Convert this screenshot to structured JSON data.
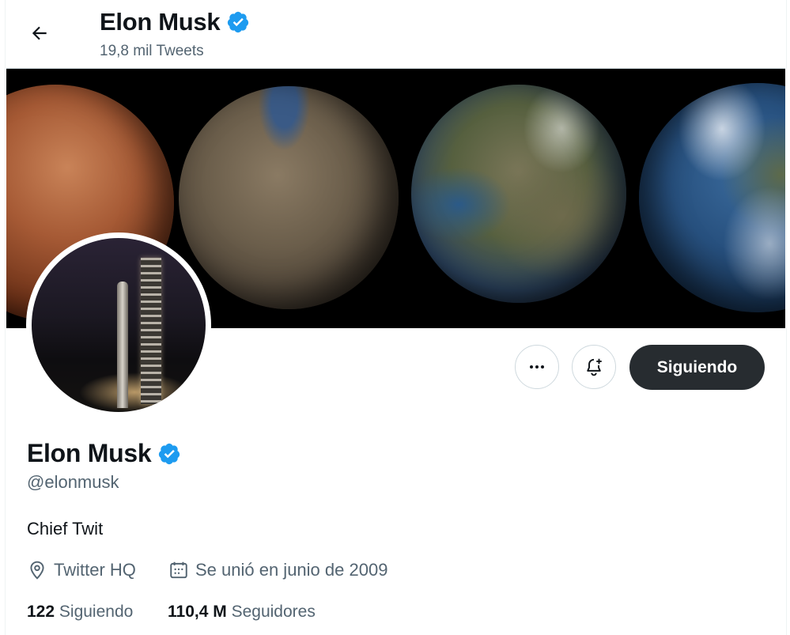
{
  "header": {
    "title": "Elon Musk",
    "tweet_count": "19,8 mil Tweets"
  },
  "profile": {
    "name": "Elon Musk",
    "handle": "@elonmusk",
    "bio": "Chief Twit",
    "location": "Twitter HQ",
    "joined": "Se unió en junio de 2009",
    "following_count": "122",
    "following_label": "Siguiendo",
    "followers_count": "110,4 M",
    "followers_label": "Seguidores",
    "verified": true
  },
  "actions": {
    "follow_label": "Siguiendo",
    "more_icon": "more-horizontal-icon",
    "notify_icon": "bell-plus-icon"
  },
  "colors": {
    "verified_blue": "#1d9bf0",
    "follow_button_bg": "#272c30",
    "secondary_text": "#536471"
  }
}
